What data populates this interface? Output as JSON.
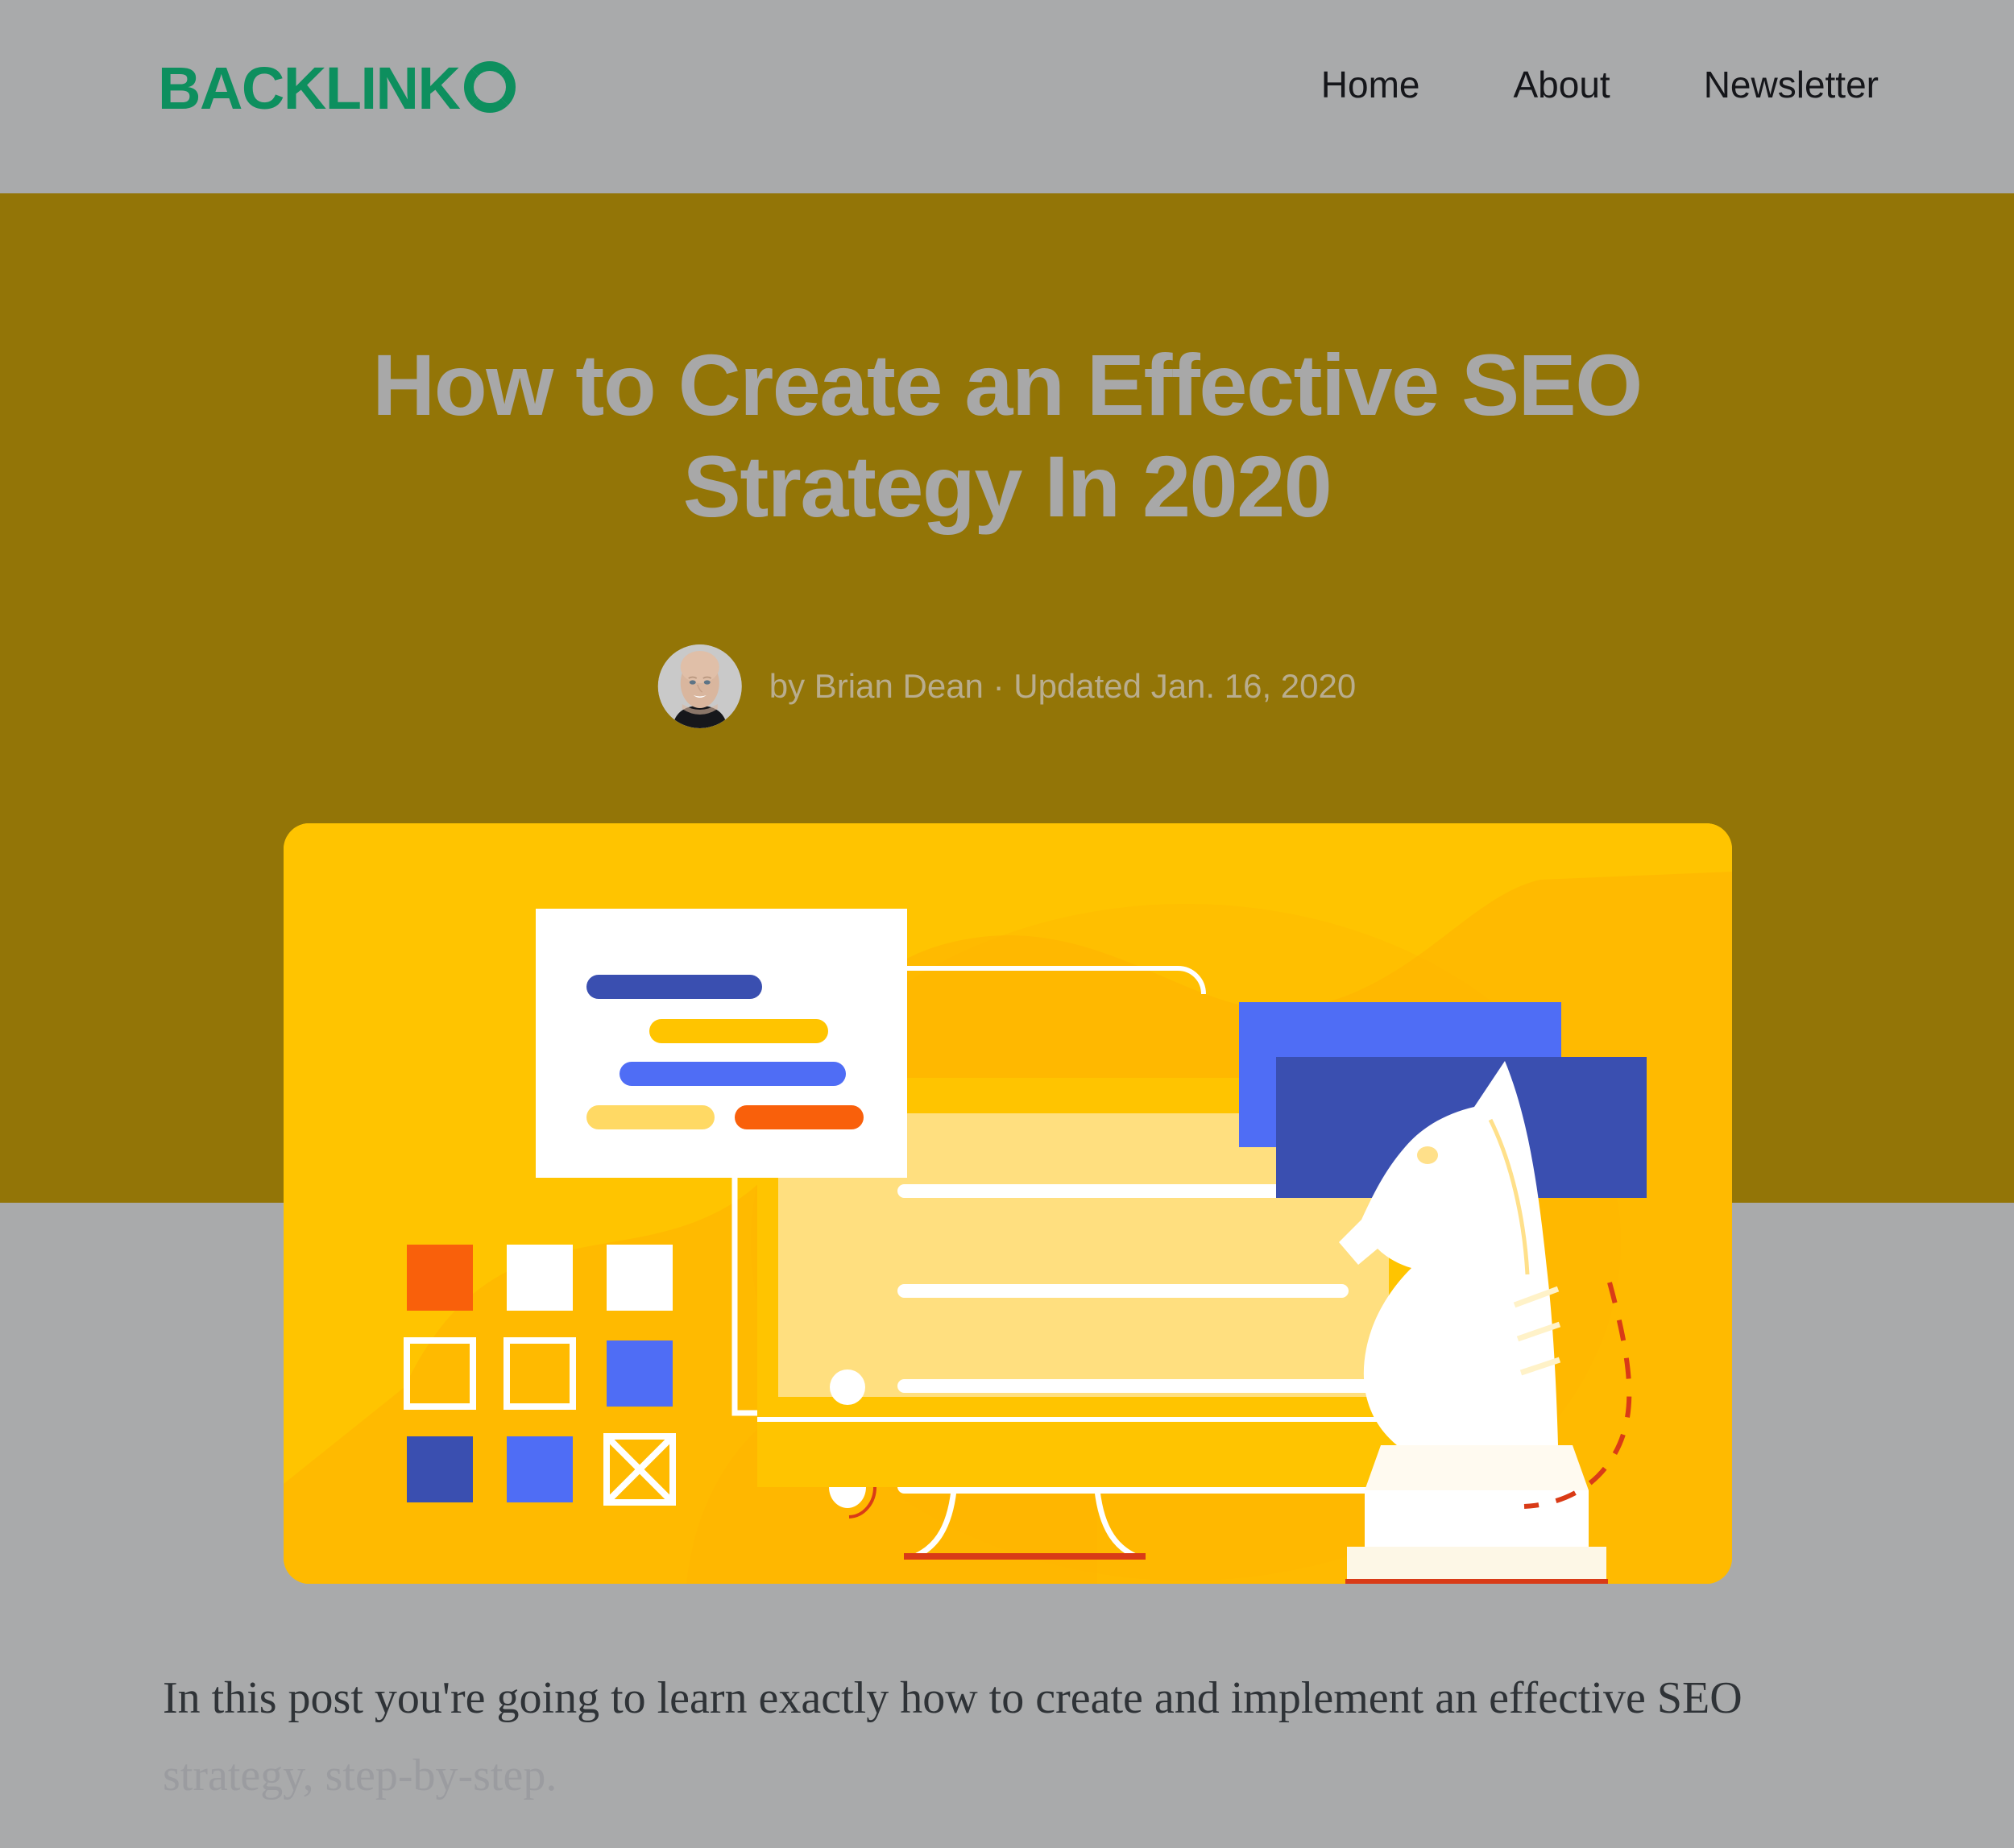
{
  "site": {
    "brand_word": "BACKLINK",
    "brand_mark_icon": "segmented-ring-icon",
    "brand_color": "#0d8f5e"
  },
  "nav": {
    "items": [
      {
        "label": "Home"
      },
      {
        "label": "About"
      },
      {
        "label": "Newsletter"
      }
    ]
  },
  "hero": {
    "title": "How to Create an Effective SEO Strategy In 2020",
    "byline": "by Brian Dean · Updated Jan. 16, 2020",
    "author_name": "Brian Dean",
    "updated_date": "Jan. 16, 2020",
    "avatar_alt": "Brian Dean headshot",
    "background_color": "#937507",
    "title_color": "#a8a8a8"
  },
  "illustration": {
    "name": "seo-strategy-hero-illustration",
    "card_color": "#ffc400",
    "elements": {
      "document_card": "white-card-with-color-bars",
      "monitor": "desktop-monitor-with-text-lines",
      "chess_knight": "white-chess-knight",
      "swatch_grid": "three-by-three-color-swatches",
      "blue_panels": "two-overlapping-blue-rectangles",
      "dashed_arc": "red-dashed-arc"
    },
    "palette": {
      "orange": "#f9600b",
      "dark_blue": "#3a4fb0",
      "bright_blue": "#4f6df5",
      "yellow": "#ffc400",
      "light_yellow": "#ffd964",
      "pale_yellow": "#ffe08a",
      "white": "#ffffff",
      "red": "#d93b17"
    }
  },
  "body": {
    "paragraph_lead": "In this post you're going to learn exactly how to create and implement an effective SEO",
    "paragraph_tail": "strategy, step-by-step.",
    "background_color": "#a9aaab"
  }
}
